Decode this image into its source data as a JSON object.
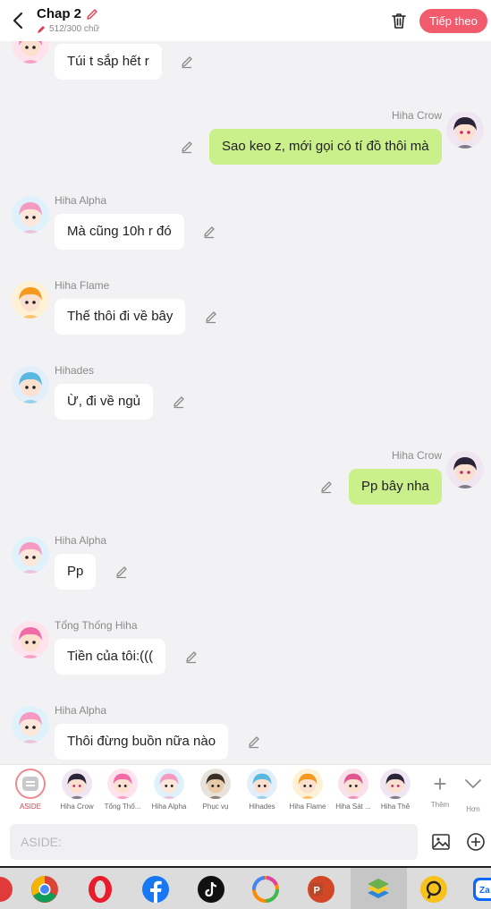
{
  "header": {
    "title": "Chap 2",
    "word_count": "512/300 chữ",
    "next_label": "Tiếp theo"
  },
  "messages": [
    {
      "side": "left",
      "name": "",
      "text": "Túi t sắp hết r",
      "avatar": "pink"
    },
    {
      "side": "right",
      "name": "Hiha Crow",
      "text": "Sao keo z, mới gọi có tí đồ thôi mà",
      "avatar": "crow"
    },
    {
      "side": "left",
      "name": "Hiha Alpha",
      "text": "Mà cũng 10h r đó",
      "avatar": "alpha"
    },
    {
      "side": "left",
      "name": "Hiha Flame",
      "text": "Thế thôi đi về bây",
      "avatar": "flame"
    },
    {
      "side": "left",
      "name": "Hihades",
      "text": "Ừ, đi về ngủ",
      "avatar": "hades"
    },
    {
      "side": "right",
      "name": "Hiha Crow",
      "text": "Pp bây nha",
      "avatar": "crow"
    },
    {
      "side": "left",
      "name": "Hiha Alpha",
      "text": "Pp",
      "avatar": "alpha"
    },
    {
      "side": "left",
      "name": "Tổng Thống Hiha",
      "text": "Tiền của tôi:(((",
      "avatar": "pink"
    },
    {
      "side": "left",
      "name": "Hiha Alpha",
      "text": "Thôi đừng buồn nữa nào",
      "avatar": "alpha"
    }
  ],
  "characters": [
    {
      "label": "ASIDE",
      "avatar": "aside",
      "active": true
    },
    {
      "label": "Hiha Crow",
      "avatar": "crow"
    },
    {
      "label": "Tổng Thố...",
      "avatar": "pink"
    },
    {
      "label": "Hiha Alpha",
      "avatar": "alpha"
    },
    {
      "label": "Phục vụ",
      "avatar": "waiter"
    },
    {
      "label": "Hihades",
      "avatar": "hades"
    },
    {
      "label": "Hiha Flame",
      "avatar": "flame"
    },
    {
      "label": "Hiha Sát ...",
      "avatar": "pink2"
    },
    {
      "label": "Hiha Thê",
      "avatar": "crow"
    }
  ],
  "tools": {
    "add_label": "Thêm",
    "more_label": "Hơn"
  },
  "input": {
    "placeholder": "ASIDE:"
  },
  "colors": {
    "accent": "#f15b6c",
    "bubble_right": "#c9f08a",
    "bubble_left": "#ffffff"
  },
  "taskbar_apps": [
    "partial-app-icon",
    "chrome-icon",
    "opera-icon",
    "facebook-icon",
    "tiktok-icon",
    "photos-icon",
    "powerpoint-icon",
    "bluestacks-icon",
    "app-icon",
    "zalo-icon"
  ]
}
